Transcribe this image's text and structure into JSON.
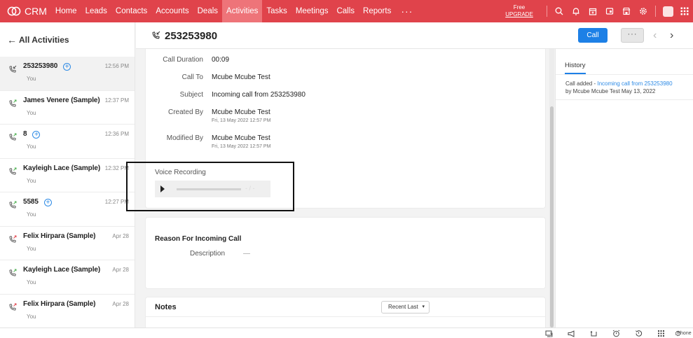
{
  "topbar": {
    "brand": "CRM",
    "nav": [
      "Home",
      "Leads",
      "Contacts",
      "Accounts",
      "Deals",
      "Activities",
      "Tasks",
      "Meetings",
      "Calls",
      "Reports"
    ],
    "active": "Activities",
    "more": "···",
    "plan": "Free",
    "upgrade": "UPGRADE",
    "icons": [
      "search-icon",
      "bell-icon",
      "calendar-add-icon",
      "window-icon",
      "marketplace-icon",
      "settings-icon",
      "profile-avatar",
      "app-grid-icon"
    ]
  },
  "left": {
    "back_label": "All Activities",
    "items": [
      {
        "name": "253253980",
        "plus": "+",
        "sub": "You",
        "time": "12:56 PM",
        "selected": true
      },
      {
        "name": "James Venere (Sample)",
        "plus": "",
        "sub": "You",
        "time": "12:37 PM"
      },
      {
        "name": "8",
        "plus": "+",
        "sub": "You",
        "time": "12:36 PM"
      },
      {
        "name": "Kayleigh Lace (Sample)",
        "plus": "",
        "sub": "You",
        "time": "12:32 PM"
      },
      {
        "name": "5585",
        "plus": "+",
        "sub": "You",
        "time": "12:27 PM"
      },
      {
        "name": "Felix Hirpara (Sample)",
        "plus": "",
        "sub": "You",
        "time": "Apr 28"
      },
      {
        "name": "Kayleigh Lace (Sample)",
        "plus": "",
        "sub": "You",
        "time": "Apr 28"
      },
      {
        "name": "Felix Hirpara (Sample)",
        "plus": "",
        "sub": "You",
        "time": "Apr 28"
      }
    ]
  },
  "header": {
    "title": "253253980",
    "call_button": "Call",
    "more_button": "···",
    "prev": "‹",
    "next": "›"
  },
  "details": {
    "call_duration_label": "Call Duration",
    "call_duration": "00:09",
    "call_to_label": "Call To",
    "call_to": "Mcube Mcube Test",
    "subject_label": "Subject",
    "subject": "Incoming call from 253253980",
    "created_by_label": "Created By",
    "created_by": "Mcube Mcube Test",
    "created_time": "Fri, 13 May 2022 12:57 PM",
    "modified_by_label": "Modified By",
    "modified_by": "Mcube Mcube Test",
    "modified_time": "Fri, 13 May 2022 12:57 PM",
    "voice_recording_label": "Voice Recording",
    "player_time": "- / -"
  },
  "reason": {
    "heading": "Reason For Incoming Call",
    "description_label": "Description",
    "description_value": "—"
  },
  "notes": {
    "heading": "Notes",
    "sort": "Recent Last",
    "caret": "▾"
  },
  "history": {
    "tab": "History",
    "entry_prefix": "Call added",
    "entry_dash": " - ",
    "entry_link": "Incoming call from 253253980",
    "entry_by": "by Mcube Mcube Test May 13, 2022"
  },
  "bottom": {
    "phone_label": "Phone",
    "icons": [
      "screen-share-icon",
      "megaphone-icon",
      "refresh-icon",
      "alarm-clock-icon",
      "history-icon",
      "dialpad-icon",
      "phone-settings-icon",
      "chat-icon"
    ]
  },
  "colors": {
    "topbar": "#e0434b",
    "active_tab": "#ee7479",
    "accent": "#1d80e6",
    "link": "#2e8be6"
  }
}
